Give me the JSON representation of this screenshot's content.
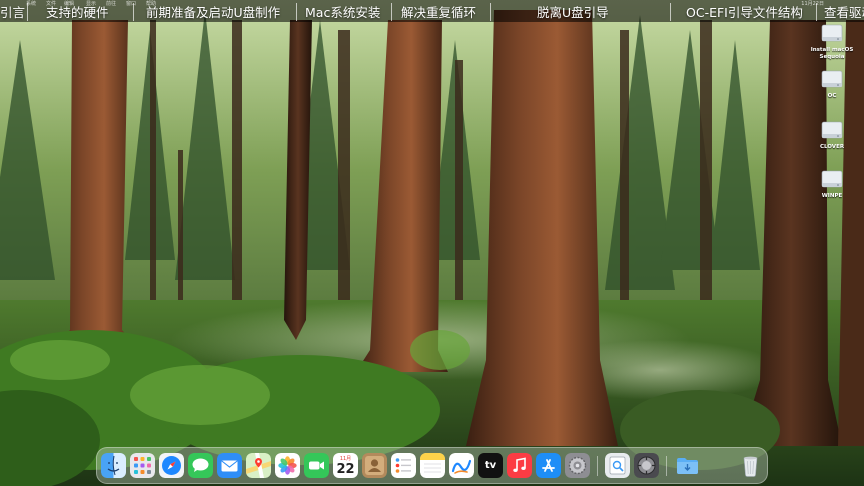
{
  "menubar": {
    "tabs": [
      {
        "label": "引言"
      },
      {
        "label": "支持的硬件"
      },
      {
        "label": "前期准备及启动U盘制作"
      },
      {
        "label": "Mac系统安装"
      },
      {
        "label": "解决重复循环"
      },
      {
        "label": "脱离U盘引导"
      },
      {
        "label": "OC-EFI引导文件结构"
      },
      {
        "label": "查看驱动"
      }
    ],
    "tiny_items": [
      "系统",
      "文件",
      "编辑",
      "显示",
      "前往",
      "窗口",
      "帮助"
    ],
    "clock": "11月22日"
  },
  "desktop": {
    "drives": [
      {
        "label": "Install macOS\nSequoia"
      },
      {
        "label": "OC"
      },
      {
        "label": "CLOVER"
      },
      {
        "label": "WINPE"
      }
    ]
  },
  "dock": {
    "calendar": {
      "month": "11月",
      "day": "22"
    },
    "tv_label": "tv",
    "apps": [
      {
        "icon": "finder-icon"
      },
      {
        "icon": "launchpad-icon"
      },
      {
        "icon": "safari-icon"
      },
      {
        "icon": "messages-icon"
      },
      {
        "icon": "mail-icon"
      },
      {
        "icon": "maps-icon"
      },
      {
        "icon": "photos-icon"
      },
      {
        "icon": "facetime-icon"
      },
      {
        "icon": "calendar-icon"
      },
      {
        "icon": "contacts-icon"
      },
      {
        "icon": "reminders-icon"
      },
      {
        "icon": "notes-icon"
      },
      {
        "icon": "freeform-icon"
      },
      {
        "icon": "tv-icon"
      },
      {
        "icon": "music-icon"
      },
      {
        "icon": "app-store-icon"
      },
      {
        "icon": "system-settings-icon"
      },
      {
        "icon": "preview-icon"
      },
      {
        "icon": "disk-utility-icon"
      },
      {
        "icon": "downloads-folder-icon"
      },
      {
        "icon": "trash-icon"
      }
    ]
  },
  "colors": {
    "accent_blue": "#1e88ff",
    "facetime_green": "#34c759",
    "music_red": "#fc3c44"
  }
}
